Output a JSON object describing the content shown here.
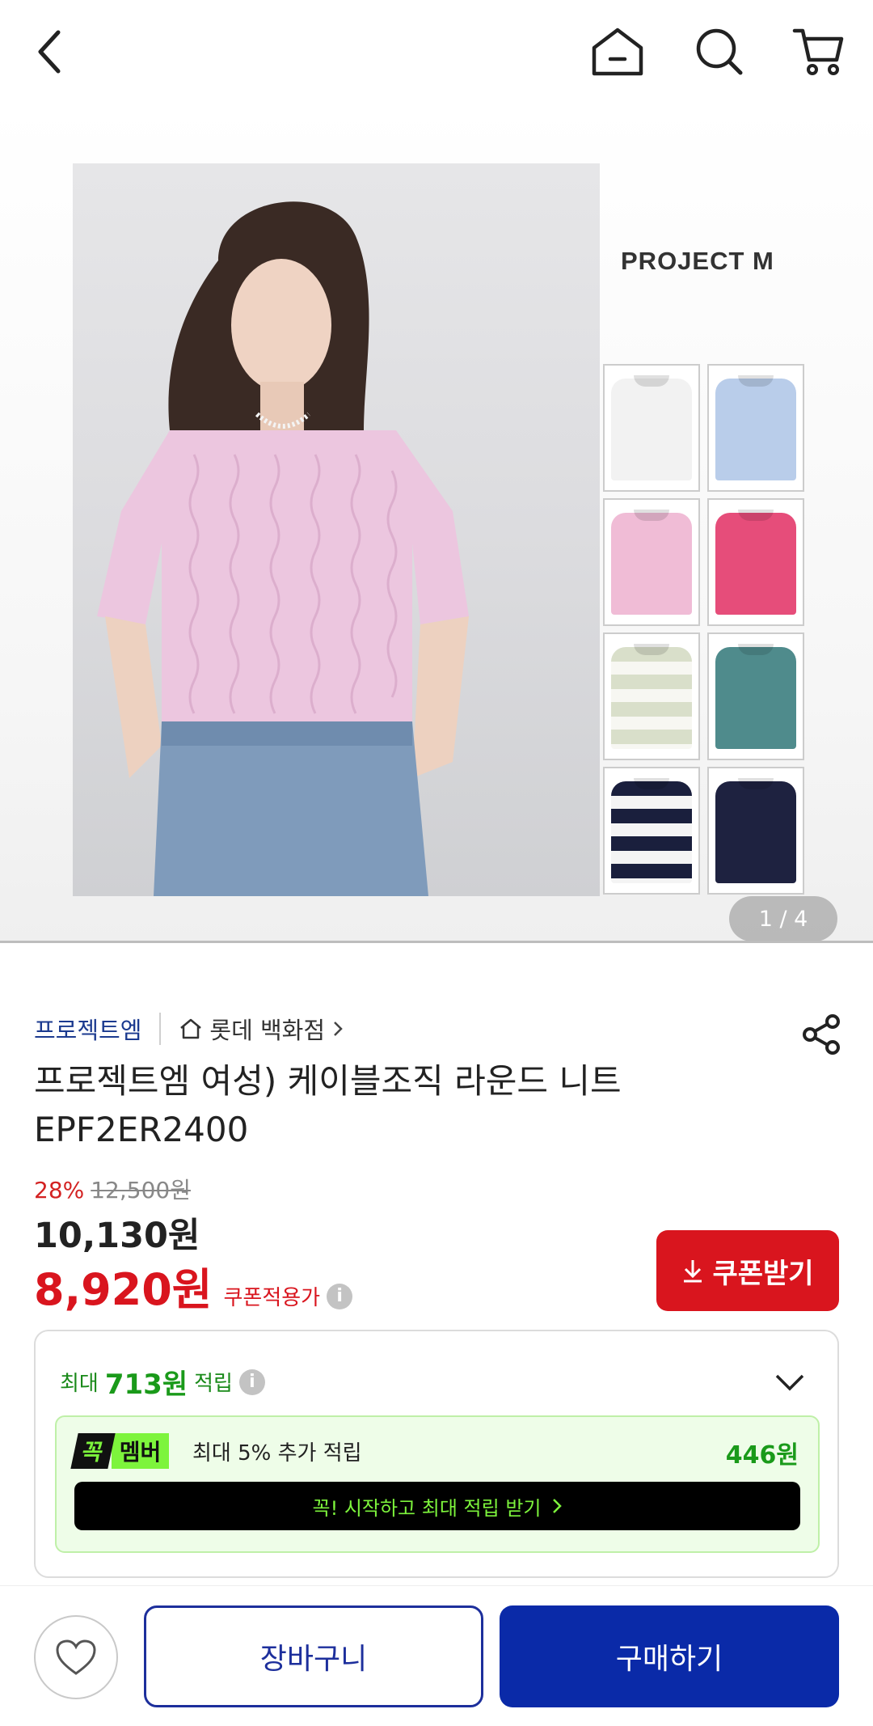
{
  "header": {
    "icons": [
      "back-icon",
      "home-icon",
      "search-icon",
      "cart-icon"
    ]
  },
  "gallery": {
    "brand_mark": "PROJECT M",
    "page_indicator": "1 / 4",
    "swatch_colors": [
      "#f2f2f2",
      "#b9cdea",
      "#f0bcd6",
      "#e64d7a",
      "#d9dfca",
      "#4f8b8c",
      "#1a1f3d",
      "#1e2240"
    ],
    "swatch_striped": [
      false,
      false,
      false,
      false,
      true,
      false,
      true,
      false
    ]
  },
  "product": {
    "brand": "프로젝트엠",
    "store": "롯데 백화점",
    "title": "프로젝트엠 여성) 케이블조직 라운드 니트 EPF2ER2400",
    "discount_rate": "28%",
    "original_price": "12,500원",
    "sale_price": "10,130원",
    "coupon_price": "8,920원",
    "coupon_note": "쿠폰적용가",
    "coupon_button": "쿠폰받기"
  },
  "points": {
    "prefix": "최대",
    "amount": "713원",
    "suffix": "적립",
    "member": {
      "badge_left": "꼭",
      "badge_right": "멤버",
      "text": "최대 5% 추가 적립",
      "amount": "446원",
      "cta": "꼭! 시작하고 최대 적립 받기"
    }
  },
  "bottom": {
    "cart_label": "장바구니",
    "buy_label": "구매하기"
  },
  "colors": {
    "accent_red": "#d9151e",
    "primary_blue": "#0a2aa8",
    "point_green": "#1a9a1a",
    "member_green": "#7df43c"
  }
}
